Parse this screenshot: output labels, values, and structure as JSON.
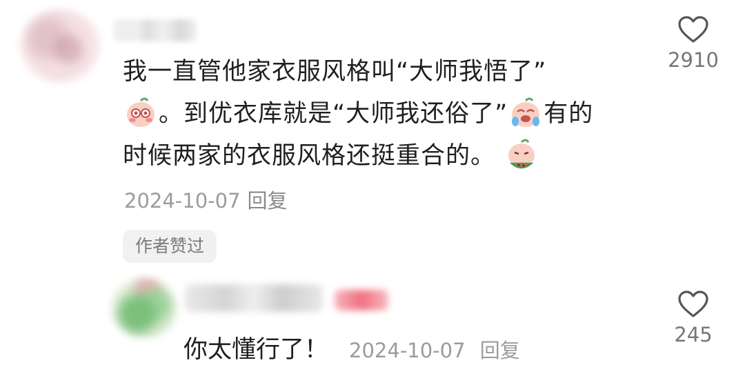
{
  "comment": {
    "line1": "我一直管他家衣服风格叫“大师我悟了”",
    "line2_a": "。到优衣库就是“大师我还俗了”",
    "line2_b": "有的",
    "line3": "时候两家的衣服风格还挺重合的。",
    "date": "2024-10-07",
    "reply_label": "回复",
    "author_liked_badge": "作者赞过",
    "like_count": "2910",
    "like_icon": "heart-outline-icon"
  },
  "reply": {
    "text": "你太懂行了！",
    "date": "2024-10-07",
    "reply_label": "回复",
    "like_count": "245",
    "like_icon": "heart-outline-icon"
  },
  "emojis": [
    "sticker-blush-icon",
    "sticker-crying-icon",
    "sticker-eating-watermelon-icon"
  ],
  "colors": {
    "text": "#1f1f1f",
    "meta": "#9b9b9b",
    "badge_bg": "#f1f1f1",
    "sticker_pink": "#f6c3b8"
  }
}
